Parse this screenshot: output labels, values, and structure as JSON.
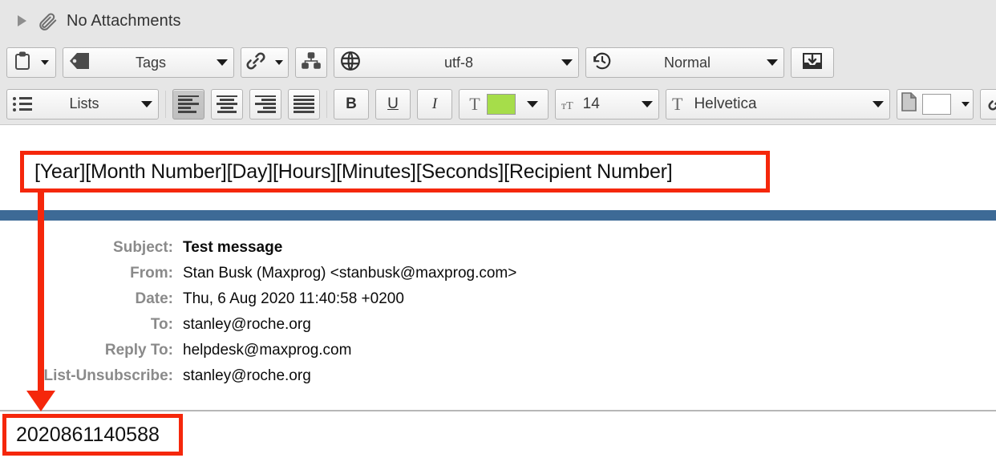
{
  "attachments_bar": {
    "disclosure_state": "collapsed",
    "paperclip_icon": "paperclip-icon",
    "label": "No Attachments"
  },
  "toolbar_row1": {
    "template_button": {
      "icon": "clipboard-icon",
      "label": ""
    },
    "tags_button": {
      "icon": "tag-icon",
      "label": "Tags"
    },
    "link_button": {
      "icon": "link-icon",
      "label": ""
    },
    "hierarchy_button": {
      "icon": "org-chart-icon",
      "label": ""
    },
    "encoding_combo": {
      "icon": "globe-icon",
      "label": "utf-8"
    },
    "priority_combo": {
      "icon": "clock-history-icon",
      "label": "Normal"
    },
    "save_button": {
      "icon": "inbox-download-icon",
      "label": ""
    }
  },
  "toolbar_row2": {
    "lists_combo": {
      "icon": "list-bullets-icon",
      "label": "Lists"
    },
    "align_left": "align-left-icon",
    "align_center": "align-center-icon",
    "align_right": "align-right-icon",
    "align_justify": "align-justify-icon",
    "bold": "B",
    "underline": "U",
    "italic": "I",
    "text_color": {
      "glyph": "T",
      "color": "#a6dd4a"
    },
    "font_size": {
      "glyph": "T",
      "value": "14"
    },
    "font_family": {
      "glyph": "T",
      "value": "Helvetica"
    },
    "page_color": {
      "icon": "page-icon",
      "color": "#ffffff"
    },
    "insert_link": "link-icon"
  },
  "annotations": {
    "accent_color": "#f5270b",
    "template_pattern": "[Year][Month Number][Day][Hours][Minutes][Seconds][Recipient Number]",
    "resolved_value": "2020861140588",
    "arrow": "down-arrow-annotation"
  },
  "divider": {
    "color": "#3d6a96"
  },
  "message_headers": [
    {
      "label": "Subject:",
      "value": "Test message",
      "bold": true
    },
    {
      "label": "From:",
      "value": "Stan Busk (Maxprog) <stanbusk@maxprog.com>",
      "bold": false
    },
    {
      "label": "Date:",
      "value": "Thu, 6 Aug 2020 11:40:58 +0200",
      "bold": false
    },
    {
      "label": "To:",
      "value": "stanley@roche.org",
      "bold": false
    },
    {
      "label": "Reply To:",
      "value": "helpdesk@maxprog.com",
      "bold": false
    },
    {
      "label": "List-Unsubscribe:",
      "value": "stanley@roche.org",
      "bold": false
    }
  ]
}
